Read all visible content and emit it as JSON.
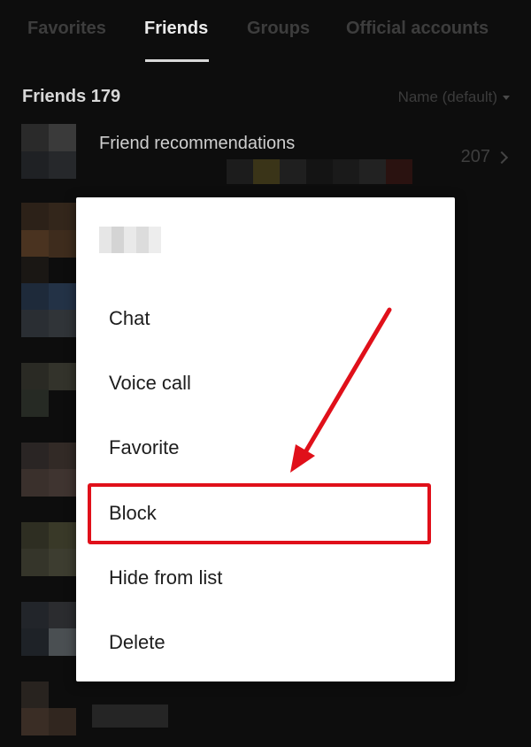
{
  "tabs": [
    {
      "label": "Favorites",
      "active": false
    },
    {
      "label": "Friends",
      "active": true
    },
    {
      "label": "Groups",
      "active": false
    },
    {
      "label": "Official accounts",
      "active": false
    }
  ],
  "friends_header": {
    "label": "Friends 179"
  },
  "sort": {
    "label": "Name (default)"
  },
  "recommendations": {
    "label": "Friend recommendations",
    "count": "207"
  },
  "dialog": {
    "menu": [
      {
        "label": "Chat"
      },
      {
        "label": "Voice call"
      },
      {
        "label": "Favorite"
      },
      {
        "label": "Block"
      },
      {
        "label": "Hide from list"
      },
      {
        "label": "Delete"
      }
    ],
    "highlighted_item": "Block"
  },
  "colors": {
    "background": "#0d0d0d",
    "dialog": "#ffffff",
    "highlight": "#e0101a"
  },
  "icons": [
    "sort-caret-icon",
    "chevron-right-icon",
    "arrow-annotation"
  ]
}
